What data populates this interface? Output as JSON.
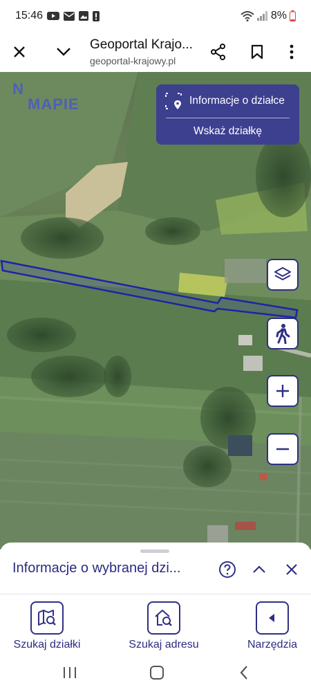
{
  "status_bar": {
    "time": "15:46",
    "battery": "8%"
  },
  "browser": {
    "title": "Geoportal Krajo...",
    "url": "geoportal-krajowy.pl"
  },
  "map": {
    "logo_line1": "N",
    "logo_line2": "MAPIE",
    "info_panel": {
      "title": "Informacje o działce",
      "action": "Wskaż działkę"
    },
    "controls": [
      "layers-icon",
      "pedestrian-icon",
      "zoom-in-icon",
      "zoom-out-icon"
    ]
  },
  "sheet": {
    "title": "Informacje o wybranej dzi..."
  },
  "tabs": [
    {
      "label": "Szukaj działki",
      "icon": "map-search-icon"
    },
    {
      "label": "Szukaj adresu",
      "icon": "home-search-icon"
    },
    {
      "label": "Narzędzia",
      "icon": "tools-arrow-icon"
    }
  ],
  "colors": {
    "brand": "#2e2f84",
    "panel": "#3d3f8f",
    "parcel_outline": "#1e22a8"
  }
}
